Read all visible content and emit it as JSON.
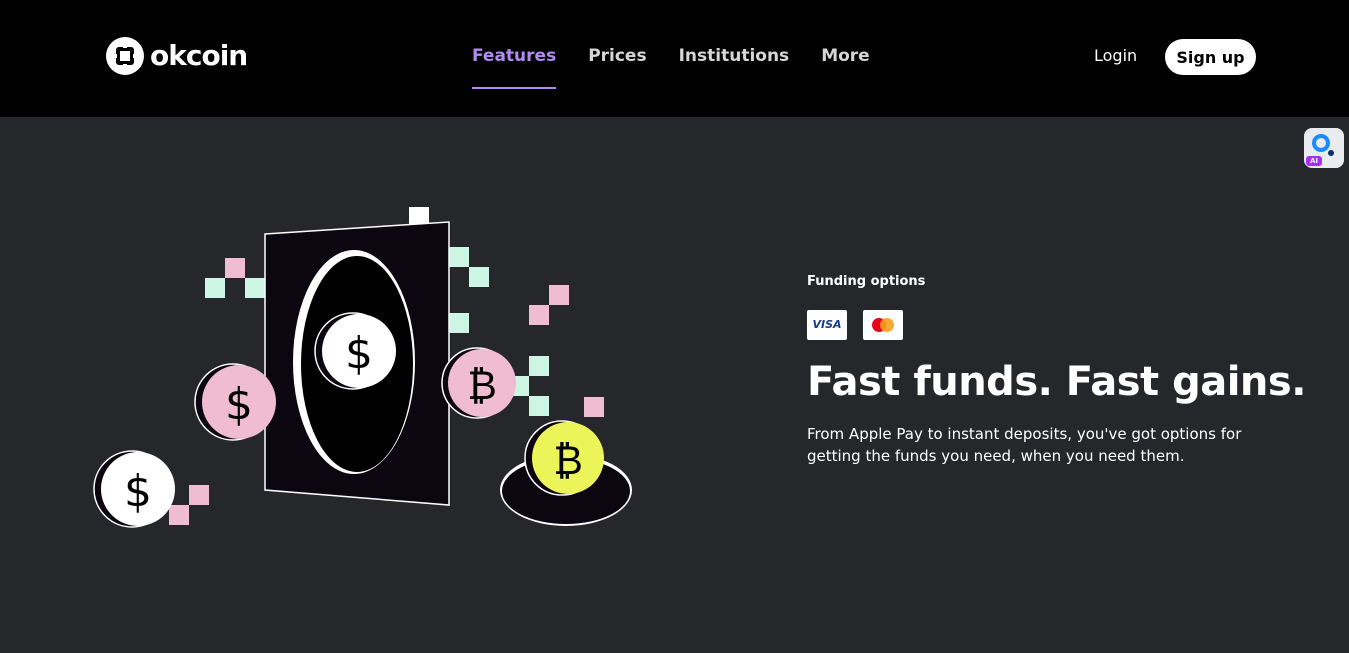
{
  "header": {
    "logo_text": "okcoin",
    "nav": [
      {
        "label": "Features",
        "active": true
      },
      {
        "label": "Prices",
        "active": false
      },
      {
        "label": "Institutions",
        "active": false
      },
      {
        "label": "More",
        "active": false
      }
    ],
    "login_label": "Login",
    "signup_label": "Sign up"
  },
  "ai_widget": {
    "badge": "AI"
  },
  "section": {
    "eyebrow": "Funding options",
    "payment_cards": [
      {
        "name": "visa-card",
        "text": "VISA"
      },
      {
        "name": "mastercard-card",
        "text": ""
      }
    ],
    "headline": "Fast funds. Fast gains.",
    "description": "From Apple Pay to instant deposits, you've got options for getting the funds you need, when you need them."
  },
  "colors": {
    "header_bg": "#000000",
    "page_bg": "#25272b",
    "accent": "#b08cf2",
    "pink": "#f0bccf",
    "mint": "#cdf5e4",
    "yellow": "#ebf55a"
  }
}
